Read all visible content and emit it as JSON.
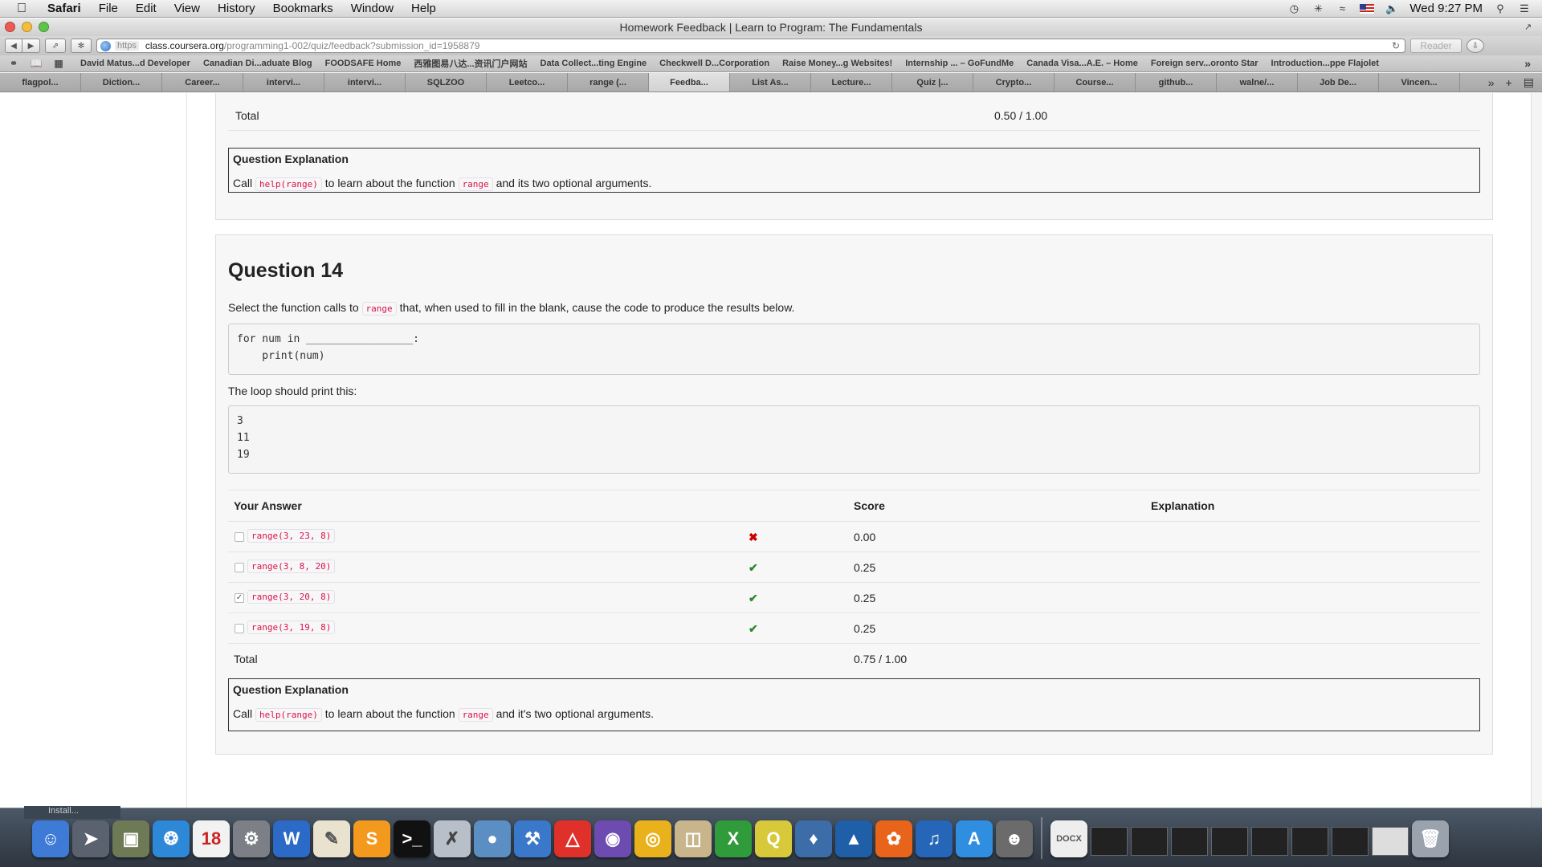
{
  "menubar": {
    "app": "Safari",
    "items": [
      "File",
      "Edit",
      "View",
      "History",
      "Bookmarks",
      "Window",
      "Help"
    ],
    "clock": "Wed 9:27 PM"
  },
  "window": {
    "title": "Homework Feedback | Learn to Program: The Fundamentals",
    "url_scheme": "https",
    "url_host": "class.coursera.org",
    "url_path": "/programming1-002/quiz/feedback?submission_id=1958879",
    "reader_label": "Reader"
  },
  "bookmarks": [
    "David Matus...d Developer",
    "Canadian Di...aduate Blog",
    "FOODSAFE Home",
    "西雅图易八达...资讯门户网站",
    "Data Collect...ting Engine",
    "Checkwell D...Corporation",
    "Raise Money...g Websites!",
    "Internship ... – GoFundMe",
    "Canada Visa...A.E. – Home",
    "Foreign serv...oronto Star",
    "Introduction...ppe Flajolet"
  ],
  "tabs": [
    "flagpol...",
    "Diction...",
    "Career...",
    "intervi...",
    "intervi...",
    "SQLZOO",
    "Leetco...",
    "range (...",
    "Feedba...",
    "List As...",
    "Lecture...",
    "Quiz |...",
    "Crypto...",
    "Course...",
    "github...",
    "walne/...",
    "Job De...",
    "Vincen..."
  ],
  "active_tab_index": 8,
  "q13": {
    "total_label": "Total",
    "total_score": "0.50 / 1.00",
    "explanation_title": "Question Explanation",
    "expl_pre": "Call",
    "expl_code1": "help(range)",
    "expl_mid": "to learn about the function",
    "expl_code2": "range",
    "expl_post": "and its two optional arguments."
  },
  "q14": {
    "title": "Question 14",
    "prompt_pre": "Select the function calls to",
    "prompt_code": "range",
    "prompt_post": "that, when used to fill in the blank, cause the code to produce the results below.",
    "code": "for num in _________________:\n    print(num)",
    "loop_label": "The loop should print this:",
    "output": "3\n11\n19",
    "table_headers": {
      "answer": "Your Answer",
      "score": "Score",
      "explanation": "Explanation"
    },
    "answers": [
      {
        "option": "range(3, 23, 8)",
        "checked": false,
        "correct": false,
        "score": "0.00"
      },
      {
        "option": "range(3, 8, 20)",
        "checked": false,
        "correct": true,
        "score": "0.25"
      },
      {
        "option": "range(3, 20, 8)",
        "checked": true,
        "correct": true,
        "score": "0.25"
      },
      {
        "option": "range(3, 19, 8)",
        "checked": false,
        "correct": true,
        "score": "0.25"
      }
    ],
    "total_label": "Total",
    "total_score": "0.75 / 1.00",
    "explanation_title": "Question Explanation",
    "expl_pre": "Call",
    "expl_code1": "help(range)",
    "expl_mid": "to learn about the function",
    "expl_code2": "range",
    "expl_post": "and it's two optional arguments."
  },
  "dock": {
    "install_label": "Install..."
  },
  "colors": {
    "code_red": "#dd1144",
    "wrong_mark": "#cc0000",
    "right_mark": "#2a8a2a"
  }
}
